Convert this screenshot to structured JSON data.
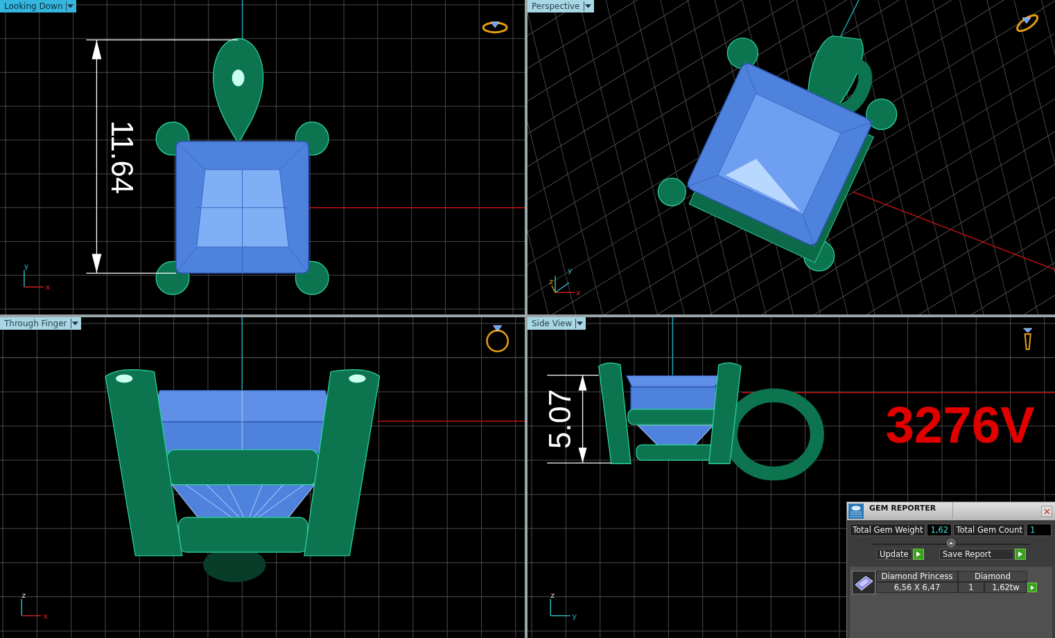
{
  "viewports": [
    {
      "label": "Looking Down",
      "selected": true,
      "kind": "top",
      "axes": [
        "y",
        "x"
      ],
      "dimension": "11.64"
    },
    {
      "label": "Perspective",
      "selected": false,
      "kind": "perspective",
      "axes": [
        "y",
        "z",
        "x"
      ]
    },
    {
      "label": "Through Finger",
      "selected": false,
      "kind": "front",
      "axes": [
        "z",
        "x"
      ]
    },
    {
      "label": "Side View",
      "selected": false,
      "kind": "side",
      "axes": [
        "z",
        "y"
      ],
      "dimension": "5.07",
      "model_code": "3276V"
    }
  ],
  "gem_reporter": {
    "title": "GEM REPORTER",
    "total_weight_label": "Total Gem Weight",
    "total_weight": "1,62",
    "total_count_label": "Total Gem Count",
    "total_count": "1",
    "buttons": [
      "Update",
      "Save Report"
    ],
    "gems": [
      {
        "name": "Diamond Princess",
        "material": "Diamond",
        "size": "6,56 X 6,47",
        "count": "1",
        "weight": "1,62tw"
      }
    ]
  }
}
